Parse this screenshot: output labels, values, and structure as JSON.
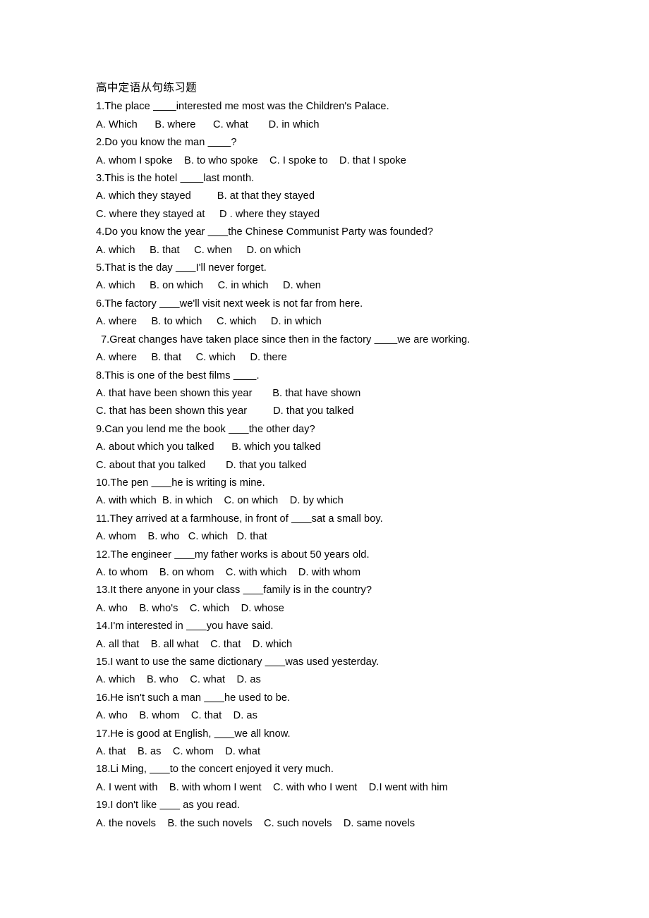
{
  "document": {
    "title": "高中定语从句练习题",
    "lines": [
      {
        "type": "question",
        "indent": 0,
        "text": "1.The place ________interested me most was the Children's Palace."
      },
      {
        "type": "options",
        "indent": 0,
        "text": "A. Which      B. where      C. what       D. in which"
      },
      {
        "type": "question",
        "indent": 0,
        "text": "2.Do you know the man ________?"
      },
      {
        "type": "options",
        "indent": 0,
        "text": "A. whom I spoke    B. to who spoke    C. I spoke to    D. that I spoke"
      },
      {
        "type": "question",
        "indent": 0,
        "text": "3.This is the hotel ________last month."
      },
      {
        "type": "options",
        "indent": 0,
        "text": "A. which they stayed         B. at that they stayed"
      },
      {
        "type": "options",
        "indent": 0,
        "text": "C. where they stayed at     D . where they stayed"
      },
      {
        "type": "question",
        "indent": 0,
        "text": "4.Do you know the year _______the Chinese Communist Party was founded?"
      },
      {
        "type": "options",
        "indent": 0,
        "text": "A. which     B. that     C. when     D. on which"
      },
      {
        "type": "question",
        "indent": 0,
        "text": "5.That is the day _______I'll never forget."
      },
      {
        "type": "options",
        "indent": 0,
        "text": "A. which     B. on which     C. in which     D. when"
      },
      {
        "type": "question",
        "indent": 0,
        "text": "6.The factory _______we'll visit next week is not far from here."
      },
      {
        "type": "options",
        "indent": 0,
        "text": "A. where     B. to which     C. which     D. in which"
      },
      {
        "type": "question",
        "indent": 1,
        "text": "7.Great changes have taken place since then in the factory ________we are working."
      },
      {
        "type": "options",
        "indent": 0,
        "text": "A. where     B. that     C. which     D. there"
      },
      {
        "type": "question",
        "indent": 0,
        "text": "8.This is one of the best films ________."
      },
      {
        "type": "options",
        "indent": 0,
        "text": "A. that have been shown this year       B. that have shown"
      },
      {
        "type": "options",
        "indent": 0,
        "text": "C. that has been shown this year         D. that you talked"
      },
      {
        "type": "question",
        "indent": 0,
        "text": "9.Can you lend me the book _______the other day?"
      },
      {
        "type": "options",
        "indent": 0,
        "text": "A. about which you talked      B. which you talked"
      },
      {
        "type": "options",
        "indent": 0,
        "text": "C. about that you talked       D. that you talked"
      },
      {
        "type": "question",
        "indent": 0,
        "text": "10.The pen _______he is writing is mine."
      },
      {
        "type": "options",
        "indent": 0,
        "text": "A. with which  B. in which    C. on which    D. by which"
      },
      {
        "type": "question",
        "indent": 0,
        "text": "11.They arrived at a farmhouse, in front of _______sat a small boy."
      },
      {
        "type": "options",
        "indent": 0,
        "text": "A. whom    B. who   C. which   D. that"
      },
      {
        "type": "question",
        "indent": 0,
        "text": "12.The engineer _______my father works is about 50 years old."
      },
      {
        "type": "options",
        "indent": 0,
        "text": "A. to whom    B. on whom    C. with which    D. with whom"
      },
      {
        "type": "question",
        "indent": 0,
        "text": "13.It there anyone in your class _______family is in the country?"
      },
      {
        "type": "options",
        "indent": 0,
        "text": "A. who    B. who's    C. which    D. whose"
      },
      {
        "type": "question",
        "indent": 0,
        "text": "14.I'm interested in _______you have said."
      },
      {
        "type": "options",
        "indent": 0,
        "text": "A. all that    B. all what    C. that    D. which"
      },
      {
        "type": "question",
        "indent": 0,
        "text": "15.I want to use the same dictionary _______was used yesterday."
      },
      {
        "type": "options",
        "indent": 0,
        "text": "A. which    B. who    C. what    D. as"
      },
      {
        "type": "question",
        "indent": 0,
        "text": "16.He isn't such a man _______he used to be."
      },
      {
        "type": "options",
        "indent": 0,
        "text": "A. who    B. whom    C. that    D. as"
      },
      {
        "type": "question",
        "indent": 0,
        "text": "17.He is good at English, _______we all know."
      },
      {
        "type": "options",
        "indent": 0,
        "text": "A. that    B. as    C. whom    D. what"
      },
      {
        "type": "question",
        "indent": 0,
        "text": "18.Li Ming, _______to the concert enjoyed it very much."
      },
      {
        "type": "options",
        "indent": 0,
        "text": "A. I went with    B. with whom I went    C. with who I went    D.I went with him"
      },
      {
        "type": "question",
        "indent": 0,
        "text": "19.I don't like _______ as you read."
      },
      {
        "type": "options",
        "indent": 0,
        "text": "A. the novels    B. the such novels    C. such novels    D. same novels"
      }
    ]
  }
}
